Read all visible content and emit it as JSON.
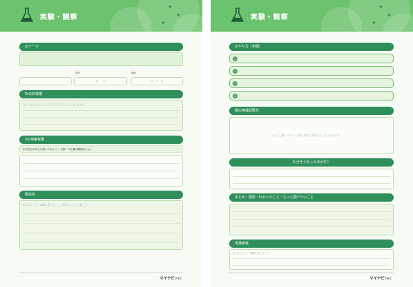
{
  "header_title": "実験・観察",
  "left": {
    "theme_bar": "のテーマ",
    "date_labels": [
      "場所",
      "場面"
    ],
    "date_fields": [
      "年　　月",
      "月　日　日"
    ],
    "section_a": "Toの日標選",
    "section_a_hint": "あいうえおかきくけこさしすせそたちつてとなにぬねの",
    "section_b": "5の持格後選",
    "section_b_note": "まず自分の考えを書いてみよう！ 正解・不正解は関係ないよ。",
    "section_c": "探究体",
    "section_c_hint": "気づいたこと・疑問に思ったこと・調べたいことを書こう"
  },
  "right": {
    "procedure_bar": "のやり方（手順）",
    "steps": [
      "1",
      "2",
      "3",
      "4"
    ],
    "result_bar": "験の用様記概日",
    "result_hint": "※ここに図・グラフ・写真・表などを貼ろう、かいてみよう！",
    "why_bar": "なぜそうなったのかな？",
    "summary_bar": "まとめ・感想・わかったこと・もっと調べたいこと",
    "extra_bar": "地選様様",
    "extra_hint": "気づいたこと・疑問に思ったこと"
  },
  "logo": {
    "main": "マイナビ",
    "sub": "子育て"
  },
  "colors": {
    "header": "#6cc36d",
    "bar": "#2f8f5b",
    "page": "#f6fbf3"
  }
}
